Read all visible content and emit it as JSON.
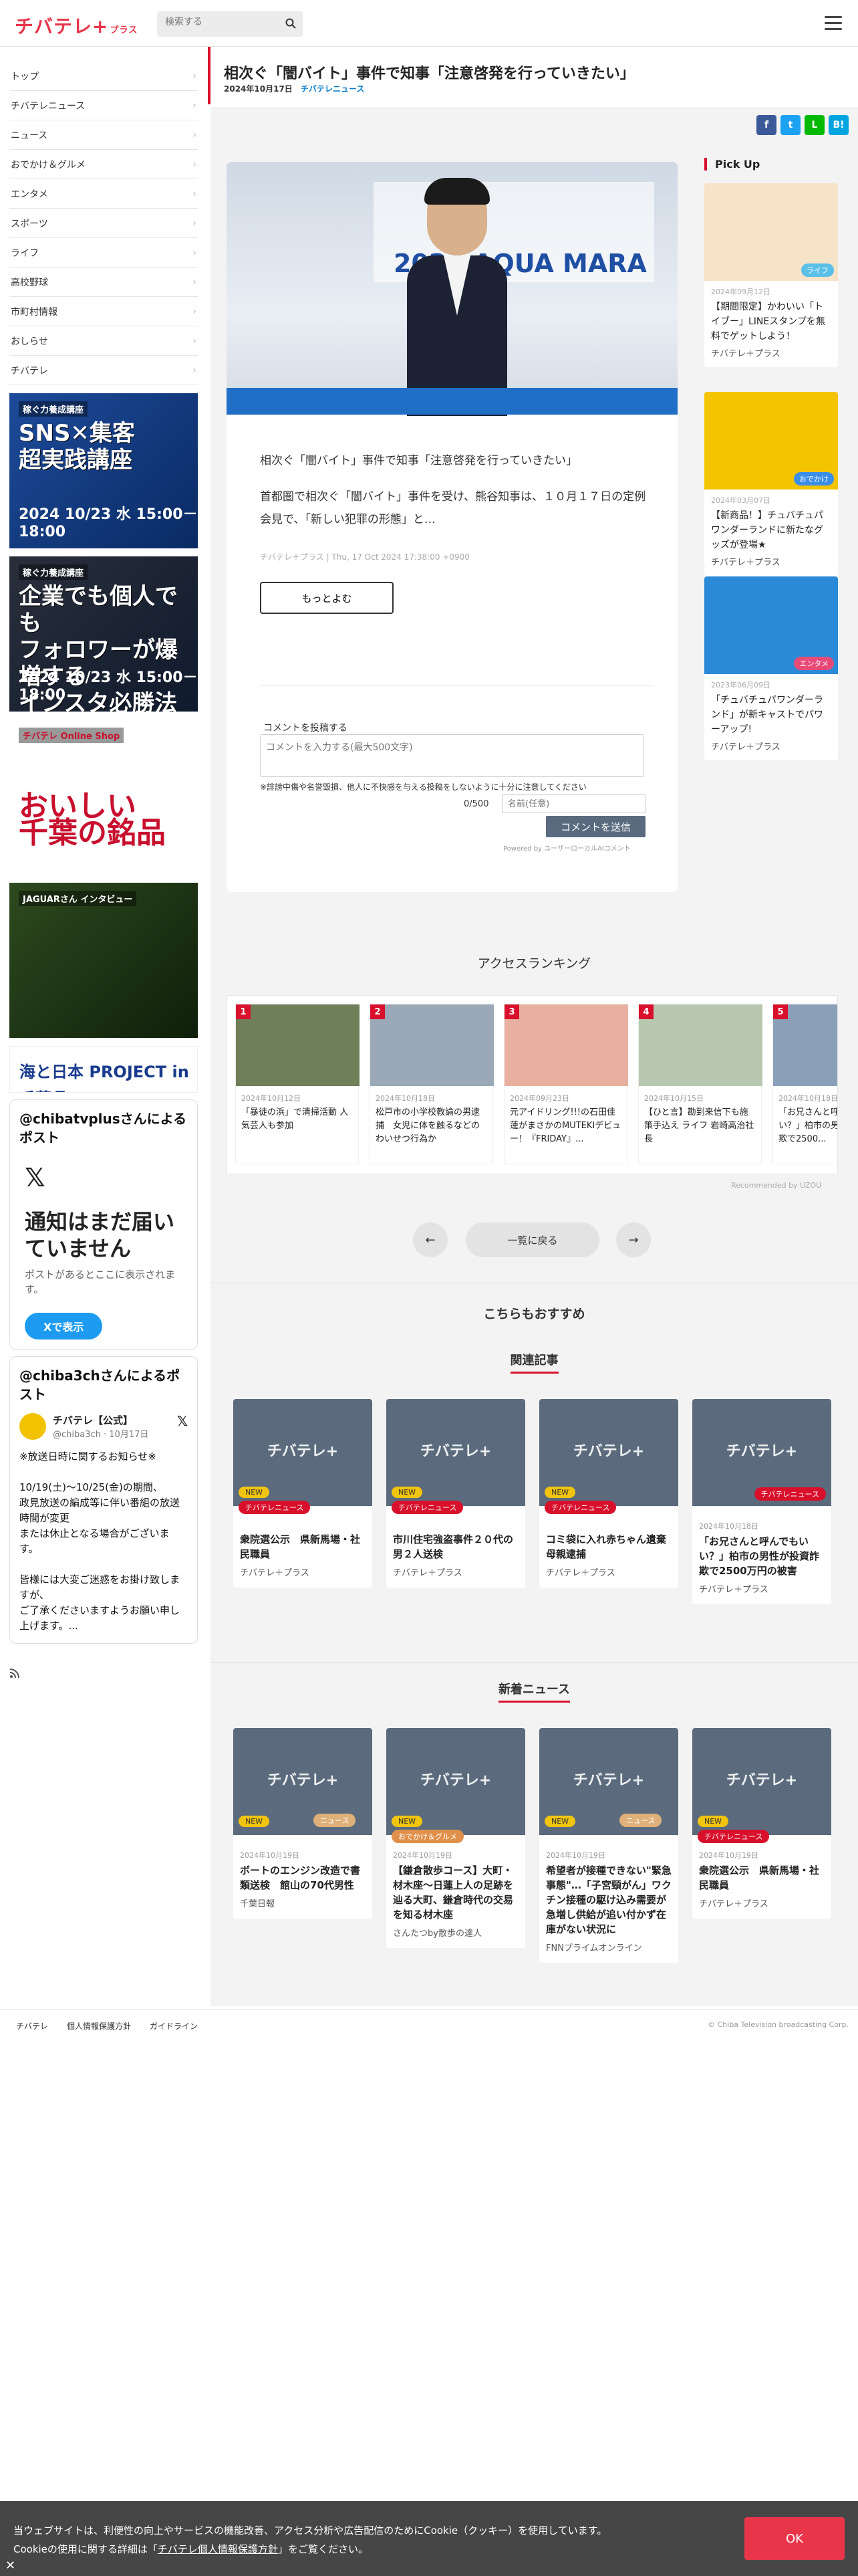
{
  "header": {
    "logo": "チバテレ+",
    "logo_suffix": "プラス",
    "search_placeholder": "検索する"
  },
  "sidebar": {
    "items": [
      {
        "label": "トップ"
      },
      {
        "label": "チバテレニュース"
      },
      {
        "label": "ニュース"
      },
      {
        "label": "おでかけ＆グルメ"
      },
      {
        "label": "エンタメ"
      },
      {
        "label": "スポーツ"
      },
      {
        "label": "ライフ"
      },
      {
        "label": "高校野球"
      },
      {
        "label": "市町村情報"
      },
      {
        "label": "おしらせ"
      },
      {
        "label": "チバテレ"
      }
    ],
    "banners": [
      {
        "sub": "稼ぐ力養成講座",
        "title": "SNS✕集客\n超実践講座",
        "date": "2024 10/23 水 15:00－18:00"
      },
      {
        "sub": "稼ぐ力養成講座",
        "title": "企業でも個人でも\nフォロワーが爆増する\nインスタ必勝法",
        "date": "2024 10/23 水 15:00－18:00"
      },
      {
        "sub": "チバテレ Online Shop",
        "title": "おいしい\n千葉の銘品",
        "date": ""
      },
      {
        "sub": "JAGUARさん インタビュー",
        "title": "",
        "date": ""
      },
      {
        "sub": "",
        "title": "海と日本 PROJECT in 千葉県",
        "date": ""
      }
    ],
    "embed1": {
      "title": "@chibatvplusさんによるポスト",
      "heading": "通知はまだ届いていません",
      "text": "ポストがあるとここに表示されます。",
      "button": "Xで表示"
    },
    "embed2": {
      "title": "@chiba3chさんによるポスト",
      "name": "チバテレ【公式】",
      "handle": "@chiba3ch · 10月17日",
      "body": "※放送日時に関するお知らせ※\n\n10/19(土)～10/25(金)の期間、\n政見放送の編成等に伴い番組の放送時間が変更\nまたは休止となる場合がございます。\n\n皆様には大変ご迷惑をお掛け致しますが、\nご了承くださいますようお願い申し上げます。..."
    }
  },
  "article": {
    "title": "相次ぐ「闇バイト」事件で知事「注意啓発を行っていきたい」",
    "date": "2024年10月17日",
    "category": "チバテレニュース",
    "summary": "相次ぐ「闇バイト」事件で知事「注意啓発を行っていきたい」",
    "body": "首都圏で相次ぐ「闇バイト」事件を受け、熊谷知事は、１０月１７日の定例会見で、「新しい犯罪の形態」と…",
    "source": "チバテレ＋プラス | Thu, 17 Oct 2024 17:38:00 +0900",
    "more": "もっとよむ",
    "image_text": "2024 AQUA MARA"
  },
  "comment": {
    "label": "コメントを投稿する",
    "placeholder": "コメントを入力する(最大500文字)",
    "note": "※誹謗中傷や名誉毀損、他人に不快感を与える投稿をしないように十分に注意してください",
    "count": "0/500",
    "name_placeholder": "名前(任意)",
    "send": "コメントを送信",
    "powered": "Powered by ユーザーローカルAIコメント"
  },
  "pickup": {
    "title": "Pick Up",
    "items": [
      {
        "date": "2024年09月12日",
        "title": "【期間限定】かわいい「トイブー」LINEスタンプを無料でゲットしよう！",
        "source": "チバテレ＋プラス",
        "badge": "ライフ"
      },
      {
        "date": "2024年03月07日",
        "title": "【新商品！】チュバチュパワンダーランドに新たなグッズが登場★",
        "source": "チバテレ＋プラス",
        "badge": "おでかけ"
      },
      {
        "date": "2023年06月09日",
        "title": "「チュバチュパワンダーランド」が新キャストでパワーアップ!",
        "source": "チバテレ＋プラス",
        "badge": "エンタメ"
      }
    ]
  },
  "ranking": {
    "title": "アクセスランキング",
    "items": [
      {
        "num": "1",
        "date": "2024年10月12日",
        "title": "「暴徒の浜」で清掃活動 人気芸人も参加"
      },
      {
        "num": "2",
        "date": "2024年10月18日",
        "title": "松戸市の小学校教諭の男逮捕　女児に体を触るなどのわいせつ行為か"
      },
      {
        "num": "3",
        "date": "2024年09月23日",
        "title": "元アイドリング!!!の石田佳蓮がまさかのMUTEKIデビュー！『FRIDAY』..."
      },
      {
        "num": "4",
        "date": "2024年10月15日",
        "title": "【ひと言】勘到来信下も施策手込え ライフ 岩崎高治社長"
      },
      {
        "num": "5",
        "date": "2024年10月18日",
        "title": "「お兄さんと呼んでもいい？」柏市の男性が投資詐欺で2500..."
      }
    ],
    "recommended": "Recommended by UZOU"
  },
  "pager": {
    "prev": "←",
    "list": "一覧に戻る",
    "next": "→"
  },
  "recommend": {
    "title": "こちらもおすすめ",
    "related_title": "関連記事",
    "related": [
      {
        "tag": "チバテレニュース",
        "title": "衆院選公示　県新馬場・社民職員",
        "source": "チバテレ＋プラス",
        "date": ""
      },
      {
        "tag": "チバテレニュース",
        "title": "市川住宅強盗事件２０代の男２人送検",
        "source": "チバテレ＋プラス",
        "date": ""
      },
      {
        "tag": "チバテレニュース",
        "title": "コミ袋に入れ赤ちゃん遺棄　母親逮捕",
        "source": "チバテレ＋プラス",
        "date": ""
      },
      {
        "tag": "チバテレニュース",
        "title": "「お兄さんと呼んでもいい？」柏市の男性が投資詐欺で2500万円の被害",
        "source": "チバテレ＋プラス",
        "date": "2024年10月18日"
      }
    ],
    "new_title": "新着ニュース",
    "new": [
      {
        "tag": "ニュース",
        "date": "2024年10月19日",
        "title": "ボートのエンジン改造で書類送検　館山の70代男性",
        "source": "千葉日報"
      },
      {
        "tag": "おでかけ＆グルメ",
        "date": "2024年10月19日",
        "title": "【鎌倉散歩コース】大町・材木座〜日蓮上人の足跡を辿る大町、鎌倉時代の交易を知る材木座",
        "source": "さんたつby散歩の達人"
      },
      {
        "tag": "ニュース",
        "date": "2024年10月19日",
        "title": "希望者が接種できない\"緊急事態\"…「子宮頸がん」ワクチン接種の駆け込み需要が急増し供給が追い付かず在庫がない状況に",
        "source": "FNNプライムオンライン"
      },
      {
        "tag": "チバテレニュース",
        "date": "2024年10月19日",
        "title": "衆院選公示　県新馬場・社民職員",
        "source": "チバテレ＋プラス"
      }
    ],
    "new_badge": "NEW"
  },
  "footer": {
    "links": [
      "チバテレ",
      "個人情報保護方針",
      "ガイドライン"
    ],
    "copyright": "© Chiba Television broadcasting Corp."
  },
  "cookie": {
    "text1": "当ウェブサイトは、利便性の向上やサービスの機能改善、アクセス分析や広告配信のためにCookie（クッキー）を使用しています。",
    "text2_pre": "Cookieの使用に関する詳細は「",
    "link": "チバテレ個人情報保護方針",
    "text2_post": "」をご覧ください。",
    "ok": "OK"
  },
  "colors": {
    "brand": "#e8354a",
    "accent_red": "#d8102c",
    "link_blue": "#0078c8"
  }
}
